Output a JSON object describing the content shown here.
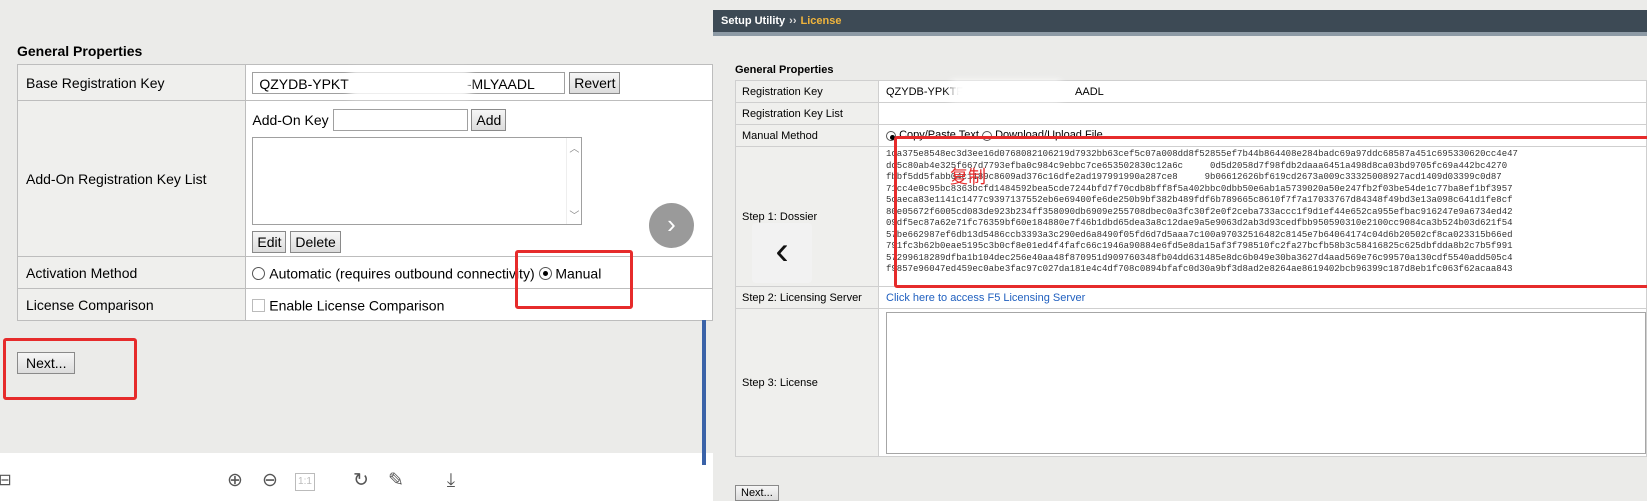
{
  "left": {
    "section_title": "General Properties",
    "rows": {
      "base_key_label": "Base Registration Key",
      "base_key_value": "QZYDB-YPKT",
      "base_key_value_tail": "-MLYAADL",
      "revert_label": "Revert",
      "addon_list_label": "Add-On Registration Key List",
      "addon_key_label": "Add-On Key",
      "add_label": "Add",
      "edit_label": "Edit",
      "delete_label": "Delete",
      "activation_label": "Activation Method",
      "automatic_label": "Automatic (requires outbound connectivity)",
      "manual_label": "Manual",
      "license_comparison_label": "License Comparison",
      "enable_comparison_label": "Enable License Comparison"
    },
    "next_label": "Next...",
    "toolbar_icons": [
      "layout-icon",
      "zoom-in-icon",
      "zoom-out-icon",
      "actual-size-icon",
      "rotate-icon",
      "edit-pencil-icon",
      "download-icon"
    ],
    "actual_size_text": "1:1"
  },
  "right": {
    "header": {
      "crumb1": "Setup Utility",
      "separator": "››",
      "crumb2": "License",
      "crumb2_color": "#f0b43c"
    },
    "section_title": "General Properties",
    "rows": {
      "reg_key_label": "Registration Key",
      "reg_key_value": "QZYDB-YPKTF",
      "reg_key_value_tail": "AADL",
      "reg_key_list_label": "Registration Key List",
      "manual_method_label": "Manual Method",
      "copy_paste_label": "Copy/Paste Text",
      "download_upload_label": "Download/Upload File",
      "step1_label": "Step 1: Dossier",
      "dossier_text": "1ca375e8548ec3d3ee16d0768082106219d7932bb63cef5c07a008dd8f52855ef7b44b864408e284badc69a97ddc68587a451c695330620cc4e47\ndc5c80ab4e325f667d7793efba0c984c9ebbc7ce653502830c12a6c　　　0d5d2058d7f98fdb2daaa6451a498d8ca03bd9705fc69a442bc4270\nfbbf5dd5fabb04c1189c8609ad376c16dfe2ad197991990a287ce8　　　9b06612626bf619cd2673a009c33325008927acd1409d03399c0d87\n71cc4e0c95bc8363bcfd1484592bea5cde7244bfd7f70cdb8bff8f5a402bbc0dbb50e6ab1a5739020a50e247fb2f03be54de1c77ba8ef1bf3957\n5caeca83e1141c1477c9397137552eb6e69400fe6de250b9bf382b489fdf6b789665c8610f7f7a17033767d84348f49bd3e13a098c641d1fe8cf\n80e05672f6005cd083de923b234ff358090db6909e255708dbec0a3fc30f2e0f2ceba733accc1f9d1ef44e652ca955efbac916247e9a6734ed42\n09df5ec87a62e71fc76359bf60e184880e7f46b1dbd65dea3a8c12dae9a5e9063d2ab3d93cedfbb950590310e2100cc9084ca3b524b03d621f54\n57be662987ef6db13d5486ccb3393a3c290ed6a8490f05fd6d7d5aaa7c100a97032516482c8145e7b64064174c04d6b20502cf8ca023315b66ed\n791fc3b62b0eae5195c3b0cf8e01ed4f4fafc66c1946a90884e6fd5e8da15af3f798510fc2fa27bcfb58b3c58416825c625dbfdda8b2c7b5f991\n57299618289dfba1b104dec256e40aa48f870951d909760348fb04dd631485e8dc6b049e30ba3627d4aad569e76c99570a130cdf5540add505c4\nf9857e96047ed459ec0abe3fac97c027da181e4c4df708c0894bfafc0d30a9bf3d8ad2e8264ae8619402bcb96399c187d8eb1fc063f62acaa843",
      "step2_label": "Step 2: Licensing Server",
      "step2_link": "Click here to access F5 Licensing Server",
      "step3_label": "Step 3: License"
    },
    "copy_annotation": "复制",
    "next_label": "Next..."
  },
  "colors": {
    "annotation_red": "#e62b2b",
    "header_bg": "#3d4a55",
    "link_blue": "#1f5fbf"
  }
}
